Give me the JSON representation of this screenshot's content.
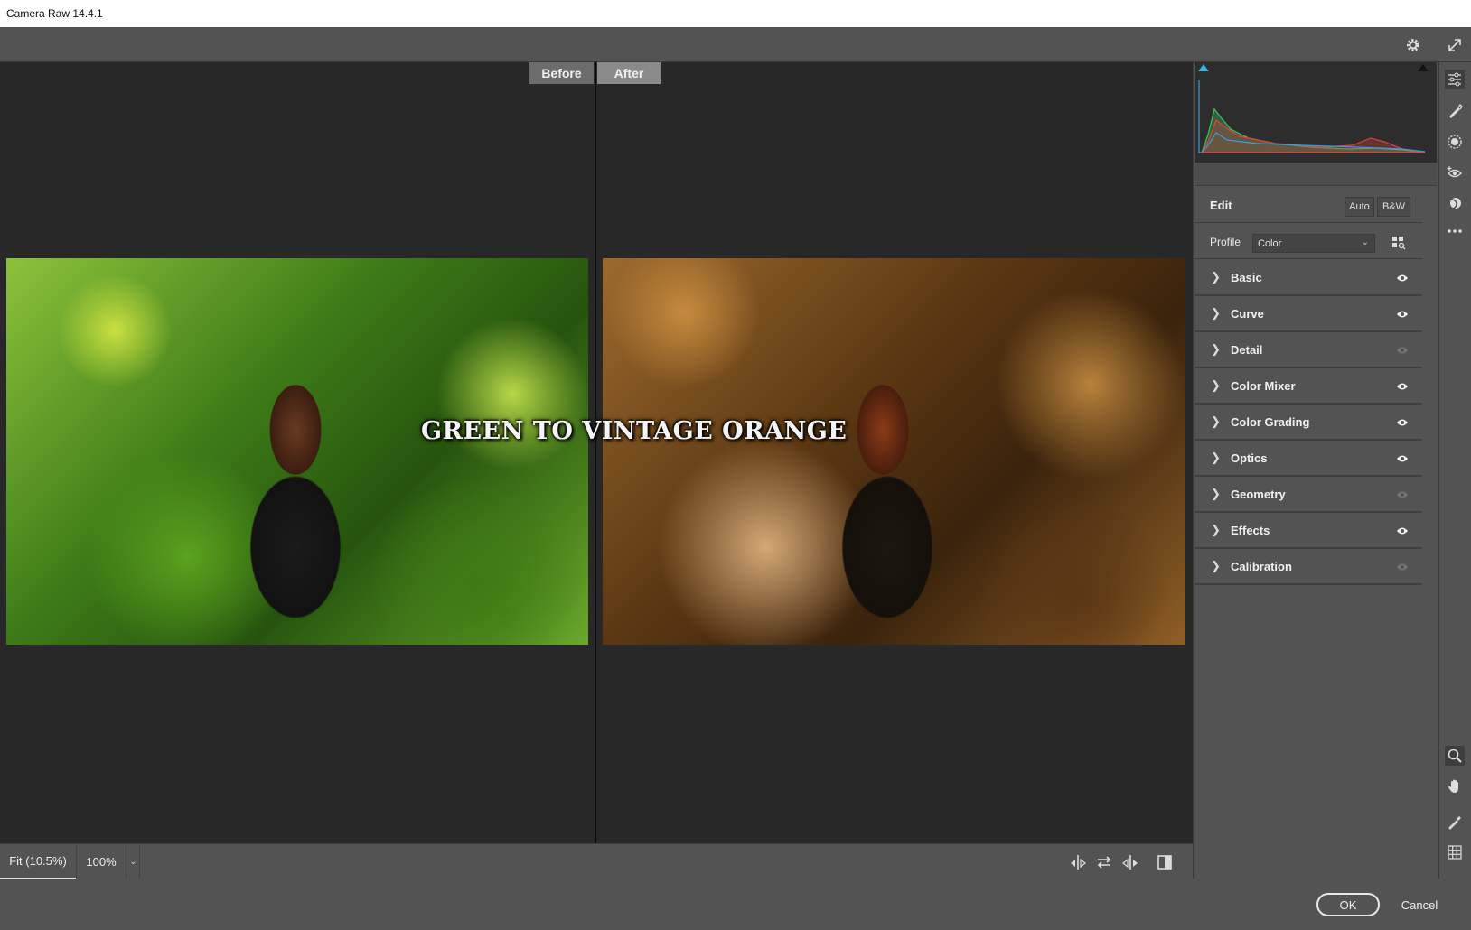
{
  "window": {
    "title": "Camera Raw 14.4.1"
  },
  "toolbar": {
    "settings_icon": "gear-icon",
    "fullscreen_icon": "expand-icon"
  },
  "compare": {
    "before_label": "Before",
    "after_label": "After"
  },
  "overlay": {
    "title": "GREEN TO VINTAGE ORANGE"
  },
  "viewbar": {
    "fit_label": "Fit (10.5%)",
    "zoom_label": "100%",
    "icons": [
      "swap-settings-icon",
      "swap-before-after-icon",
      "copy-settings-icon",
      "toggle-view-icon"
    ]
  },
  "edit_panel": {
    "title": "Edit",
    "auto_label": "Auto",
    "bw_label": "B&W",
    "profile_label": "Profile",
    "profile_value": "Color",
    "sections": [
      {
        "label": "Basic",
        "visible": true
      },
      {
        "label": "Curve",
        "visible": true
      },
      {
        "label": "Detail",
        "visible": false
      },
      {
        "label": "Color Mixer",
        "visible": true
      },
      {
        "label": "Color Grading",
        "visible": true
      },
      {
        "label": "Optics",
        "visible": true
      },
      {
        "label": "Geometry",
        "visible": false
      },
      {
        "label": "Effects",
        "visible": true
      },
      {
        "label": "Calibration",
        "visible": false
      }
    ]
  },
  "tools": [
    "edit-sliders-icon",
    "healing-brush-icon",
    "masking-icon",
    "red-eye-icon",
    "presets-icon",
    "more-icon",
    "zoom-icon",
    "hand-icon",
    "color-sampler-icon",
    "grid-icon"
  ],
  "footer": {
    "ok_label": "OK",
    "cancel_label": "Cancel"
  },
  "colors": {
    "panel": "#535353",
    "canvas": "#282828",
    "histogram_blue": "#3a9be0",
    "histogram_red": "#e04040",
    "histogram_green": "#40c060"
  }
}
